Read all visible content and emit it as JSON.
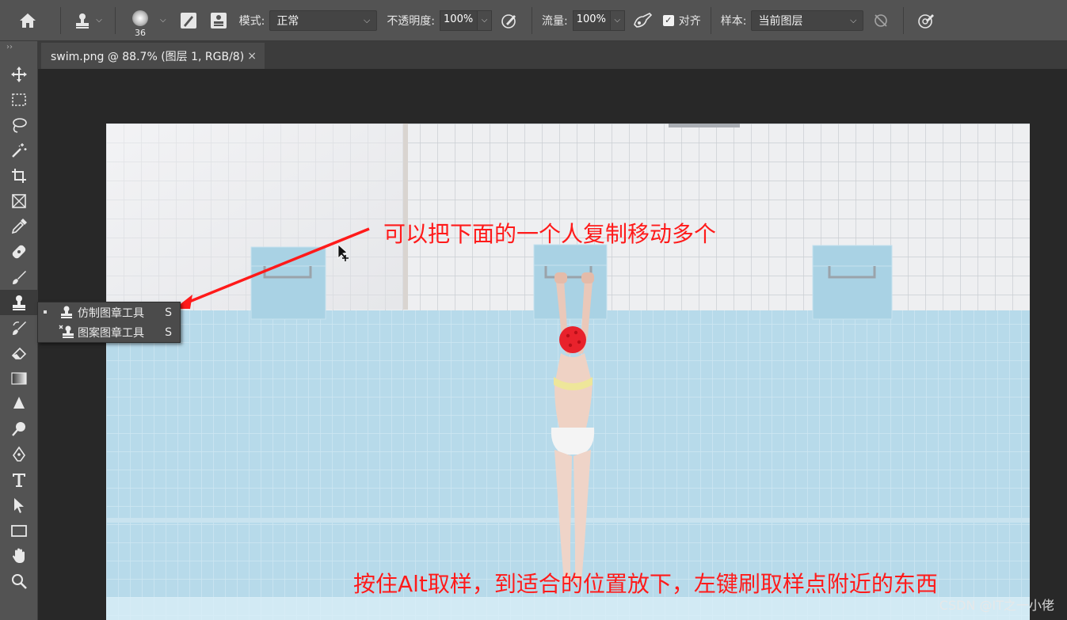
{
  "options_bar": {
    "brush_size": "36",
    "mode_label": "模式:",
    "mode_value": "正常",
    "opacity_label": "不透明度:",
    "opacity_value": "100%",
    "flow_label": "流量:",
    "flow_value": "100%",
    "aligned_label": "对齐",
    "aligned_checked": true,
    "sample_label": "样本:",
    "sample_value": "当前图层"
  },
  "document_tab": {
    "title": "swim.png @ 88.7% (图层 1, RGB/8)",
    "close": "×"
  },
  "toolbar": {
    "tools": [
      "move-tool",
      "marquee-tool",
      "lasso-tool",
      "magic-wand-tool",
      "crop-tool",
      "frame-tool",
      "eyedropper-tool",
      "healing-brush-tool",
      "brush-tool",
      "clone-stamp-tool",
      "history-brush-tool",
      "eraser-tool",
      "gradient-tool",
      "blur-tool",
      "dodge-tool",
      "pen-tool",
      "type-tool",
      "path-selection-tool",
      "rectangle-tool",
      "hand-tool",
      "zoom-tool"
    ],
    "active_tool": "clone-stamp-tool"
  },
  "flyout": {
    "items": [
      {
        "label": "仿制图章工具",
        "key": "S",
        "selected": true
      },
      {
        "label": "图案图章工具",
        "key": "S",
        "selected": false
      }
    ]
  },
  "annotations": {
    "top": "可以把下面的一个人复制移动多个",
    "bottom": "按住Alt取样，到适合的位置放下，左键刷取样点附近的东西",
    "color": "#ff1a1a"
  },
  "watermark": "CSDN @IT之一小佬"
}
